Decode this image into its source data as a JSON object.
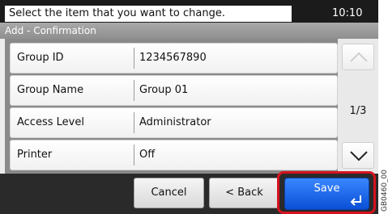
{
  "header": {
    "message": "Select the item that you want to change.",
    "time": "10:10"
  },
  "screen_title": "Add - Confirmation",
  "rows": [
    {
      "label": "Group ID",
      "value": "1234567890"
    },
    {
      "label": "Group Name",
      "value": "Group 01"
    },
    {
      "label": "Access Level",
      "value": "Administrator"
    },
    {
      "label": "Printer",
      "value": "Off"
    }
  ],
  "pager": {
    "indicator": "1/3",
    "up_icon": "chevron-up-icon",
    "down_icon": "chevron-down-icon"
  },
  "buttons": {
    "cancel": "Cancel",
    "back": "< Back",
    "save": "Save",
    "save_icon": "enter-icon"
  },
  "side_code": "GB0460_00",
  "colors": {
    "save_blue": "#1f66f0",
    "highlight_red": "#d5131f",
    "top_bar": "#1b1b1b",
    "title_bar": "#9b9b9b"
  }
}
